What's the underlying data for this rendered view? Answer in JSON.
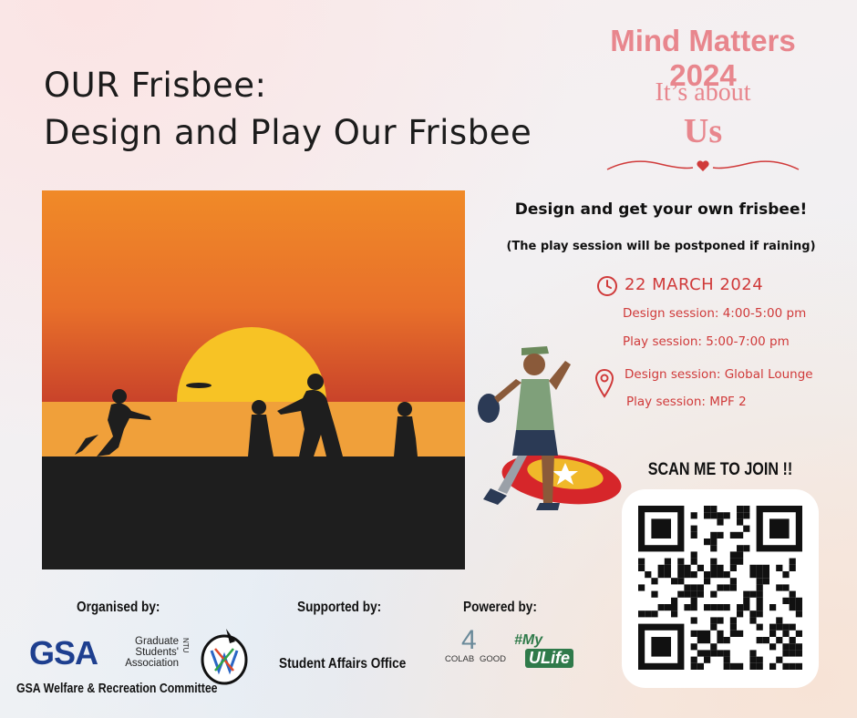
{
  "event": {
    "title_line1": "OUR Frisbee:",
    "title_line2": "Design and Play Our Frisbee",
    "tagline": "Design and get your own frisbee!",
    "rain_note": "(The play session will be postponed if raining)",
    "date": "22 MARCH 2024",
    "design_time": "Design session: 4:00-5:00 pm",
    "play_time": "Play session: 5:00-7:00 pm",
    "design_venue": "Design session: Global Lounge",
    "play_venue": "Play session: MPF 2",
    "scan_cta": "SCAN ME TO JOIN !!"
  },
  "branding": {
    "series": "Mind Matters 2024",
    "slogan_line1": "It’s about",
    "slogan_line2": "Us"
  },
  "footer": {
    "organised_label": "Organised by:",
    "supported_label": "Supported by:",
    "powered_label": "Powered by:",
    "gsa_mark": "GSA",
    "gsa_line1": "Graduate",
    "gsa_line2": "Students'",
    "gsa_line3": "Association",
    "gsa_ntu": "NTU",
    "committee": "GSA Welfare & Recreation Committee",
    "supporter": "Student Affairs Office",
    "colab_line1": "COLAB",
    "colab_line2": "GOOD",
    "colab_num": "4",
    "myulife_line1": "#My",
    "myulife_line2": "ULife"
  },
  "icons": [
    "clock-icon",
    "location-pin-icon",
    "heart-icon",
    "qr-code"
  ],
  "colors": {
    "accent_red": "#d03a3a",
    "pink": "#e8868d",
    "gsa_blue": "#1e3f8f",
    "sky_orange": "#f18a2a",
    "sun_yellow": "#f7c325"
  }
}
